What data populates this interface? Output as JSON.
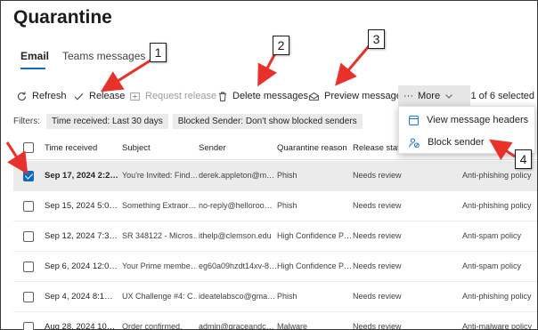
{
  "page": {
    "title": "Quarantine"
  },
  "tabs": [
    {
      "label": "Email",
      "active": true
    },
    {
      "label": "Teams messages",
      "active": false
    }
  ],
  "toolbar": {
    "refresh": "Refresh",
    "release": "Release",
    "request_release": "Request release",
    "delete": "Delete messages",
    "preview": "Preview message",
    "more_dots": "···",
    "more": "More",
    "selected": "1 of 6 selected"
  },
  "filters": {
    "label": "Filters:",
    "chips": [
      "Time received: Last 30 days",
      "Blocked Sender: Don't show blocked senders"
    ]
  },
  "table": {
    "columns": [
      "Time received",
      "Subject",
      "Sender",
      "Quarantine reason",
      "Release status"
    ],
    "rows": [
      {
        "time": "Sep 17, 2024 2:2…",
        "subject": "You're Invited: Find…",
        "sender": "derek.appleton@m…",
        "reason": "Phish",
        "status": "Needs review",
        "policy": "Anti-phishing policy",
        "checked": true
      },
      {
        "time": "Sep 15, 2024 5:0…",
        "subject": "Something Extraor…",
        "sender": "no-reply@helloroo…",
        "reason": "Phish",
        "status": "Needs review",
        "policy": "Anti-phishing policy",
        "checked": false
      },
      {
        "time": "Sep 12, 2024 7:3…",
        "subject": "SR 348122 - Micros…",
        "sender": "ithelp@clemson.edu",
        "reason": "High Confidence P…",
        "status": "Needs review",
        "policy": "Anti-spam policy",
        "checked": false
      },
      {
        "time": "Sep 6, 2024 12:0…",
        "subject": "Your Prime membe…",
        "sender": "eg60a09hzdt14xv-8…",
        "reason": "High Confidence P…",
        "status": "Needs review",
        "policy": "Anti-spam policy",
        "checked": false
      },
      {
        "time": "Sep 4, 2024 8:1…",
        "subject": "UX Challenge #4: C…",
        "sender": "ideatelabsco@gma…",
        "reason": "Phish",
        "status": "Needs review",
        "policy": "Anti-phishing policy",
        "checked": false
      },
      {
        "time": "Aug 28, 2024 10…",
        "subject": "Order confirmed.",
        "sender": "admin@graceandc…",
        "reason": "Malware",
        "status": "Needs review",
        "policy": "Anti-malware policy",
        "checked": false
      }
    ]
  },
  "more_menu": {
    "items": [
      "View message headers",
      "Block sender"
    ]
  },
  "callouts": [
    "1",
    "2",
    "3",
    "4"
  ],
  "colors": {
    "accent": "#0f6cbd",
    "arrow": "#e8312a"
  },
  "icons": [
    "refresh-icon",
    "checkmark-icon",
    "request-release-icon",
    "trash-icon",
    "envelope-open-icon",
    "chevron-down-icon",
    "message-headers-icon",
    "block-person-icon"
  ]
}
